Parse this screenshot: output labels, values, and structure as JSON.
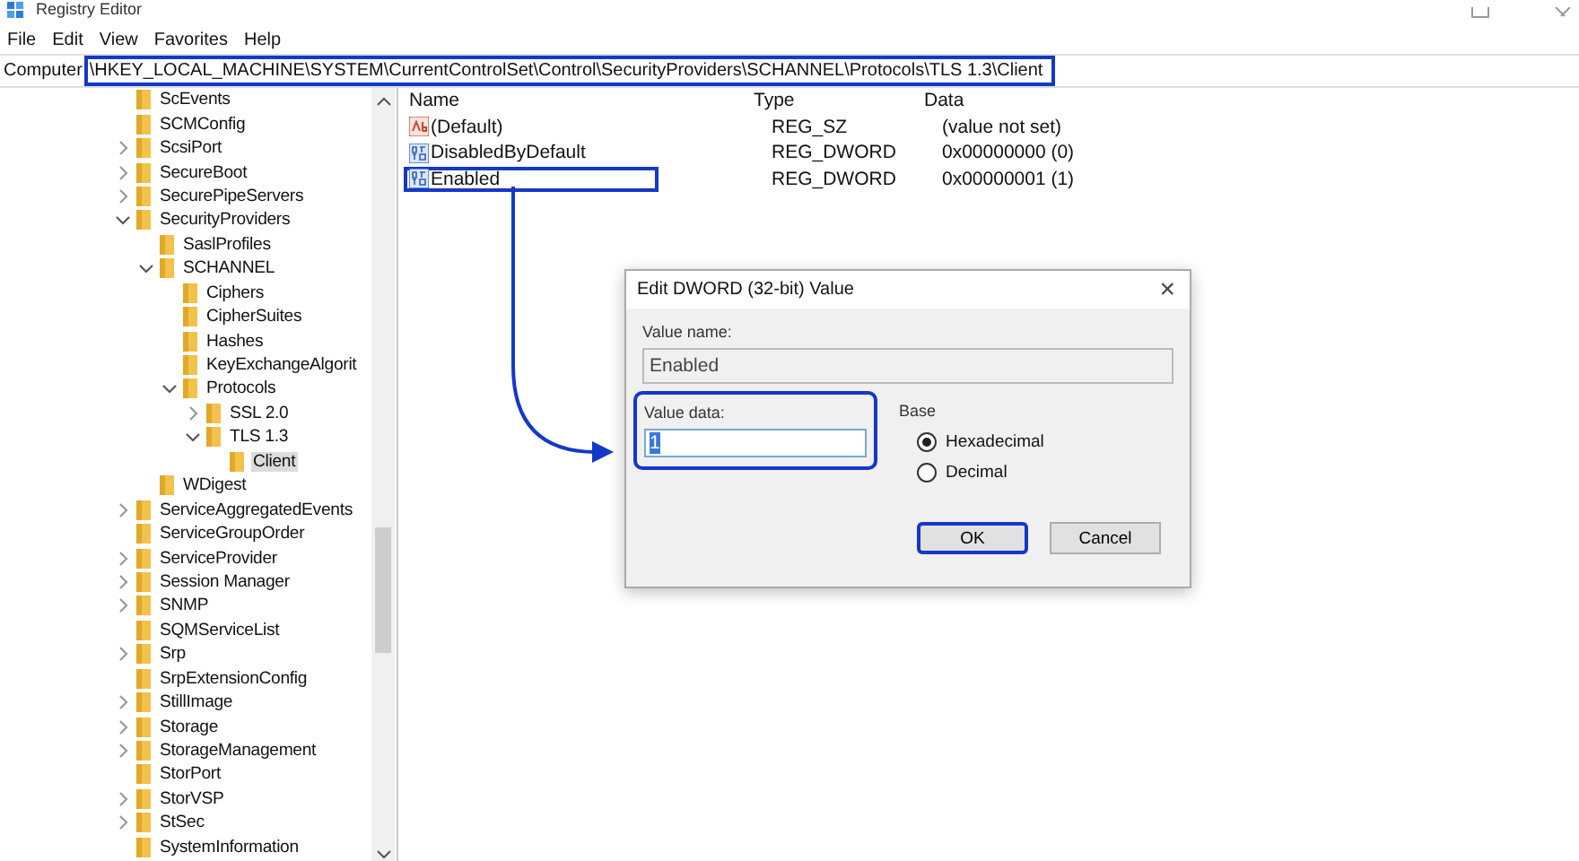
{
  "window": {
    "title": "Registry Editor"
  },
  "menu": [
    "File",
    "Edit",
    "View",
    "Favorites",
    "Help"
  ],
  "address": {
    "root": "Computer",
    "path": "\\HKEY_LOCAL_MACHINE\\SYSTEM\\CurrentControlSet\\Control\\SecurityProviders\\SCHANNEL\\Protocols\\TLS 1.3\\Client",
    "highlighted": true
  },
  "tree": {
    "items": [
      {
        "label": "ScEvents",
        "selected": false
      },
      {
        "label": "SCMConfig",
        "selected": false
      },
      {
        "label": "ScsiPort",
        "expanded": false,
        "selected": false
      },
      {
        "label": "SecureBoot",
        "expanded": false,
        "selected": false
      },
      {
        "label": "SecurePipeServers",
        "expanded": false,
        "selected": false
      },
      {
        "label": "SecurityProviders",
        "expanded": true,
        "selected": false,
        "children": [
          {
            "label": "SaslProfiles",
            "selected": false
          },
          {
            "label": "SCHANNEL",
            "expanded": true,
            "selected": false,
            "children": [
              {
                "label": "Ciphers",
                "selected": false
              },
              {
                "label": "CipherSuites",
                "selected": false
              },
              {
                "label": "Hashes",
                "selected": false
              },
              {
                "label": "KeyExchangeAlgorit",
                "selected": false
              },
              {
                "label": "Protocols",
                "expanded": true,
                "selected": false,
                "children": [
                  {
                    "label": "SSL 2.0",
                    "expanded": false,
                    "selected": false
                  },
                  {
                    "label": "TLS 1.3",
                    "expanded": true,
                    "selected": false,
                    "children": [
                      {
                        "label": "Client",
                        "selected": true
                      }
                    ]
                  }
                ]
              }
            ]
          },
          {
            "label": "WDigest",
            "selected": false
          }
        ]
      },
      {
        "label": "ServiceAggregatedEvents",
        "expanded": false,
        "selected": false
      },
      {
        "label": "ServiceGroupOrder",
        "selected": false
      },
      {
        "label": "ServiceProvider",
        "expanded": false,
        "selected": false
      },
      {
        "label": "Session Manager",
        "expanded": false,
        "selected": false
      },
      {
        "label": "SNMP",
        "expanded": false,
        "selected": false
      },
      {
        "label": "SQMServiceList",
        "selected": false
      },
      {
        "label": "Srp",
        "expanded": false,
        "selected": false
      },
      {
        "label": "SrpExtensionConfig",
        "selected": false
      },
      {
        "label": "StillImage",
        "expanded": false,
        "selected": false
      },
      {
        "label": "Storage",
        "expanded": false,
        "selected": false
      },
      {
        "label": "StorageManagement",
        "expanded": false,
        "selected": false
      },
      {
        "label": "StorPort",
        "selected": false
      },
      {
        "label": "StorVSP",
        "expanded": false,
        "selected": false
      },
      {
        "label": "StSec",
        "expanded": false,
        "selected": false
      },
      {
        "label": "SystemInformation",
        "selected": false
      }
    ]
  },
  "values": {
    "columns": [
      "Name",
      "Type",
      "Data"
    ],
    "rows": [
      {
        "kind": "string",
        "name": "(Default)",
        "type": "REG_SZ",
        "data": "(value not set)",
        "highlighted": false
      },
      {
        "kind": "binary",
        "name": "DisabledByDefault",
        "type": "REG_DWORD",
        "data": "0x00000000 (0)",
        "highlighted": false
      },
      {
        "kind": "binary",
        "name": "Enabled",
        "type": "REG_DWORD",
        "data": "0x00000001 (1)",
        "highlighted": true
      }
    ]
  },
  "dialog": {
    "title": "Edit DWORD (32-bit) Value",
    "close": "×",
    "value_name_label": "Value name:",
    "value_name": "Enabled",
    "value_data_label": "Value data:",
    "value_data": "1",
    "value_data_highlighted": true,
    "base_label": "Base",
    "bases": [
      {
        "label": "Hexadecimal",
        "selected": true
      },
      {
        "label": "Decimal",
        "selected": false
      }
    ],
    "buttons": [
      {
        "label": "OK",
        "highlighted": true
      },
      {
        "label": "Cancel",
        "highlighted": false
      }
    ]
  }
}
